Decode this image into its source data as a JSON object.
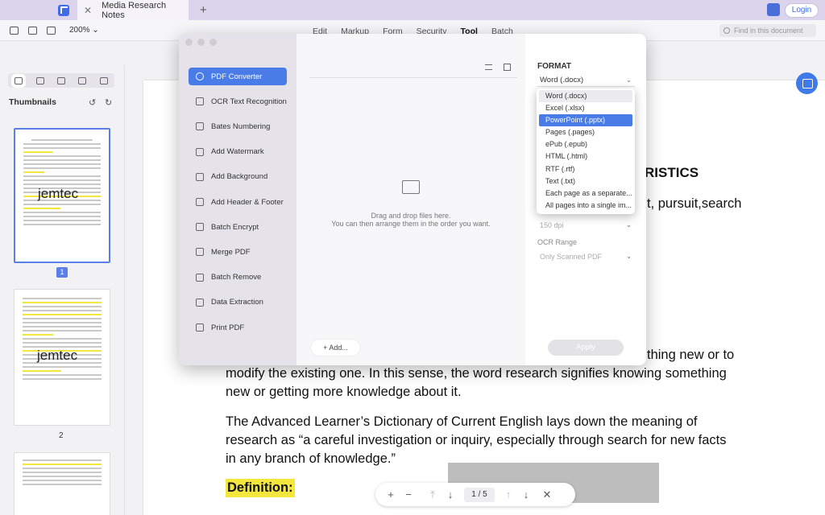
{
  "tabbar": {
    "tab_title": "Media Research Notes",
    "login_label": "Login"
  },
  "toolbar": {
    "zoom": "200%",
    "menu": [
      "Edit",
      "Markup",
      "Form",
      "Security",
      "Tool",
      "Batch"
    ],
    "active_menu": "Tool",
    "find_placeholder": "Find in this document"
  },
  "sidebar": {
    "title": "Thumbnails",
    "page1_label": "1",
    "page2_label": "2",
    "watermark": "jemtec"
  },
  "document": {
    "heading_fragment": "RISTICS",
    "line_fragment": "t, pursuit,search",
    "para1_line0": "thing new or to",
    "para1_line1": "modify the existing one. In this sense, the word research signifies  knowing something",
    "para1_line2": "new or getting more knowledge about it.",
    "para2_line1": "The Advanced Learner’s Dictionary of Current English lays down the meaning of",
    "para2_line2": "research as “a careful investigation or inquiry, especially through search for new facts",
    "para2_line3": "in any branch of knowledge.”",
    "definition_label": "Definition:"
  },
  "page_nav": {
    "current": "1",
    "separator": "/",
    "total": "5"
  },
  "dialog": {
    "title": "PDF Converter",
    "tools": [
      {
        "label": "PDF Converter",
        "icon": "refresh-icon"
      },
      {
        "label": "OCR Text Recognition",
        "icon": "ocr-icon"
      },
      {
        "label": "Bates Numbering",
        "icon": "bates-icon"
      },
      {
        "label": "Add Watermark",
        "icon": "watermark-icon"
      },
      {
        "label": "Add Background",
        "icon": "background-icon"
      },
      {
        "label": "Add Header & Footer",
        "icon": "header-footer-icon"
      },
      {
        "label": "Batch Encrypt",
        "icon": "lock-icon"
      },
      {
        "label": "Merge PDF",
        "icon": "merge-icon"
      },
      {
        "label": "Batch Remove",
        "icon": "trash-icon"
      },
      {
        "label": "Data Extraction",
        "icon": "extract-icon"
      },
      {
        "label": "Print PDF",
        "icon": "printer-icon"
      }
    ],
    "drop_line1": "Drag and drop files here.",
    "drop_line2": "You can then arrange them in the order you want.",
    "add_label": "Add...",
    "format_label": "FORMAT",
    "format_value": "Word (.docx)",
    "dpi_value": "150 dpi",
    "ocr_label": "OCR Range",
    "ocr_value": "Only Scanned PDF",
    "apply_label": "Apply",
    "format_options": [
      "Word (.docx)",
      "Excel (.xlsx)",
      "PowerPoint (.pptx)",
      "Pages (.pages)",
      "ePub (.epub)",
      "HTML (.html)",
      "RTF (.rtf)",
      "Text (.txt)",
      "Each page as a separate...",
      "All pages into a single im..."
    ],
    "hovered_option": "Word (.docx)",
    "selected_option": "PowerPoint (.pptx)"
  },
  "colors": {
    "accent": "#4a7ce8",
    "highlight": "#f3e63c",
    "tabbar": "#dcd3ec"
  }
}
